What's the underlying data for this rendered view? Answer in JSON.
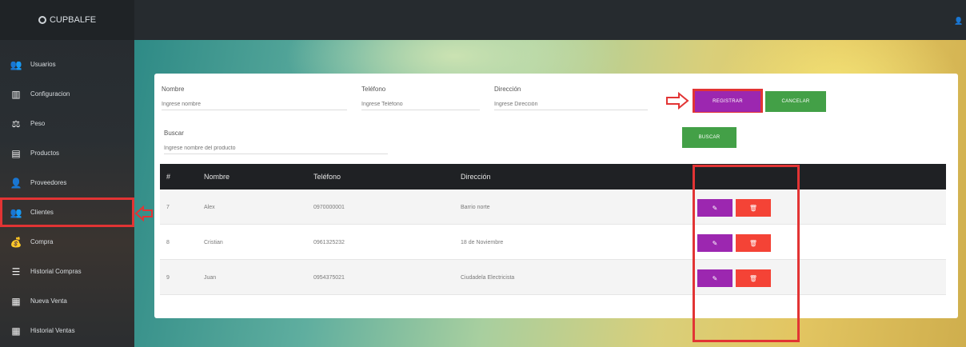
{
  "brand": {
    "name": "CUPBALFE",
    "logo_icon": "recycle-icon"
  },
  "topbar": {
    "user_icon": "user-icon"
  },
  "sidebar": {
    "items": [
      {
        "label": "Usuarios",
        "icon": "users-icon",
        "glyph": "👥"
      },
      {
        "label": "Configuracion",
        "icon": "building-icon",
        "glyph": "▥"
      },
      {
        "label": "Peso",
        "icon": "scale-icon",
        "glyph": "⚖"
      },
      {
        "label": "Productos",
        "icon": "box-icon",
        "glyph": "▤"
      },
      {
        "label": "Proveedores",
        "icon": "supplier-icon",
        "glyph": "👤"
      },
      {
        "label": "Clientes",
        "icon": "clients-icon",
        "glyph": "👥",
        "active": true
      },
      {
        "label": "Compra",
        "icon": "money-bag-icon",
        "glyph": "💰"
      },
      {
        "label": "Historial Compras",
        "icon": "list-icon",
        "glyph": "☰"
      },
      {
        "label": "Nueva Venta",
        "icon": "cash-register-icon",
        "glyph": "▦"
      },
      {
        "label": "Historial Ventas",
        "icon": "table-icon",
        "glyph": "▦"
      }
    ]
  },
  "form": {
    "nombre": {
      "label": "Nombre",
      "placeholder": "Ingrese nombre"
    },
    "telefono": {
      "label": "Teléfono",
      "placeholder": "Ingrese Teléfono"
    },
    "direccion": {
      "label": "Dirección",
      "placeholder": "Ingrese Dirección"
    },
    "buscar": {
      "label": "Buscar",
      "placeholder": "Ingrese nombre del producto"
    },
    "registrar_label": "REGISTRAR",
    "cancelar_label": "CANCELAR",
    "buscar_label": "BUSCAR"
  },
  "table": {
    "columns": [
      "#",
      "Nombre",
      "Teléfono",
      "Dirección",
      ""
    ],
    "rows": [
      {
        "id": "7",
        "nombre": "Alex",
        "telefono": "0970000001",
        "direccion": "Barrio norte"
      },
      {
        "id": "8",
        "nombre": "Cristian",
        "telefono": "0961325232",
        "direccion": "18 de Noviembre"
      },
      {
        "id": "9",
        "nombre": "Juan",
        "telefono": "0954375021",
        "direccion": "Ciudadela Electricista"
      }
    ],
    "edit_glyph": "✎",
    "delete_glyph": "🗑"
  },
  "colors": {
    "accent_purple": "#9c27b0",
    "accent_green": "#43a047",
    "danger_red": "#f44336",
    "highlight_red": "#e23434",
    "sidebar_dark": "#262b2f"
  }
}
